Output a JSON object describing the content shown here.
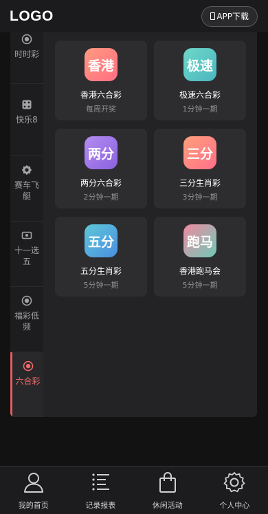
{
  "header": {
    "logo": "LOGO",
    "app_download": "APP下载"
  },
  "sidebar": {
    "items": [
      {
        "label": "时时彩",
        "icon": "radio-icon",
        "active": false
      },
      {
        "label": "快乐8",
        "icon": "dice-icon",
        "active": false
      },
      {
        "label": "赛车飞艇",
        "icon": "gear-badge-icon",
        "active": false
      },
      {
        "label": "十一选五",
        "icon": "ticket-icon",
        "active": false
      },
      {
        "label": "福彩低频",
        "icon": "radio-icon",
        "active": false
      },
      {
        "label": "六合彩",
        "icon": "radio-icon",
        "active": true
      }
    ]
  },
  "games": [
    {
      "badge": "香港",
      "title": "香港六合彩",
      "subtitle": "每周开奖",
      "colors": [
        "#ff9a80",
        "#ff6f82"
      ]
    },
    {
      "badge": "极速",
      "title": "极速六合彩",
      "subtitle": "1分钟一期",
      "colors": [
        "#6fd8c8",
        "#4bb6c0"
      ]
    },
    {
      "badge": "两分",
      "title": "两分六合彩",
      "subtitle": "2分钟一期",
      "colors": [
        "#b58cf0",
        "#8a62e0"
      ]
    },
    {
      "badge": "三分",
      "title": "三分生肖彩",
      "subtitle": "3分钟一期",
      "colors": [
        "#ffa07a",
        "#ff6f8a"
      ]
    },
    {
      "badge": "五分",
      "title": "五分生肖彩",
      "subtitle": "5分钟一期",
      "colors": [
        "#5fc7d8",
        "#4a8fe0"
      ]
    },
    {
      "badge": "跑马",
      "title": "香港跑马会",
      "subtitle": "5分钟一期",
      "colors": [
        "#f08aa0",
        "#6fc9b8"
      ]
    }
  ],
  "bottom_nav": {
    "items": [
      {
        "label": "我的首页",
        "icon": "user-icon"
      },
      {
        "label": "记录报表",
        "icon": "list-icon"
      },
      {
        "label": "休闲活动",
        "icon": "bag-icon"
      },
      {
        "label": "个人中心",
        "icon": "gear-icon"
      }
    ]
  }
}
